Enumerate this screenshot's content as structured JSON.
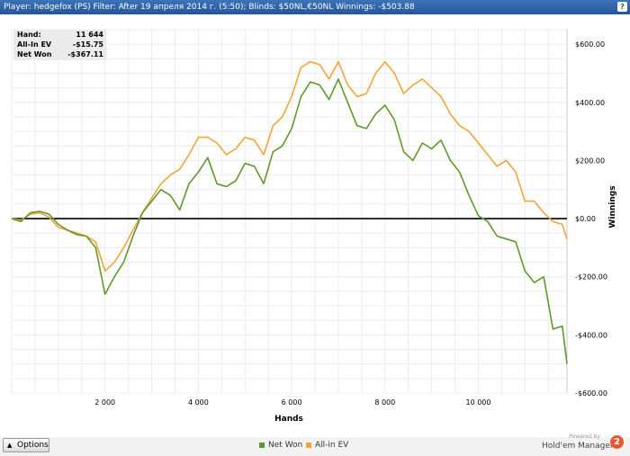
{
  "header": {
    "title": "Player: hedgefox (PS)  Filter:  After 19 апреля 2014 г. (5:50); Blinds: $50NL,€50NL  Winnings:  -$503.88",
    "help_label": "?"
  },
  "stats": [
    {
      "label": "Hand:",
      "value": "11 644"
    },
    {
      "label": "All-In EV",
      "value": "-$15.75"
    },
    {
      "label": "Net Won",
      "value": "-$367.11"
    }
  ],
  "options_label": "Options",
  "legend": [
    {
      "name": "Net Won",
      "color": "#5f9a2c"
    },
    {
      "name": "All-in EV",
      "color": "#f5a33c"
    }
  ],
  "powered": {
    "small": "Powered by",
    "brand": "Hold'em Manager",
    "logo": "2"
  },
  "colors": {
    "net_won": "#5f9a2c",
    "all_in_ev": "#f5a33c",
    "zero_line": "#000000",
    "title_bar": "#2c5ea3"
  },
  "chart_data": {
    "type": "line",
    "xlabel": "Hands",
    "ylabel": "Winnings",
    "xlim": [
      0,
      11900
    ],
    "ylim": [
      -600,
      650
    ],
    "x_ticks": [
      2000,
      4000,
      6000,
      8000,
      10000
    ],
    "x_tick_labels": [
      "2 000",
      "4 000",
      "6 000",
      "8 000",
      "10 000"
    ],
    "y_ticks": [
      600,
      400,
      200,
      0,
      -200,
      -400,
      -600
    ],
    "y_tick_labels": [
      "$600.00",
      "$400.00",
      "$200.00",
      "$0.00",
      "-$200.00",
      "-$400.00",
      "-$600.00"
    ],
    "grid": true,
    "legend_position": "bottom-center",
    "x": [
      0,
      200,
      400,
      600,
      800,
      1000,
      1200,
      1400,
      1600,
      1800,
      2000,
      2200,
      2400,
      2600,
      2800,
      3000,
      3200,
      3400,
      3600,
      3800,
      4000,
      4200,
      4400,
      4600,
      4800,
      5000,
      5200,
      5400,
      5600,
      5800,
      6000,
      6200,
      6400,
      6600,
      6800,
      7000,
      7200,
      7400,
      7600,
      7800,
      8000,
      8200,
      8400,
      8600,
      8800,
      9000,
      9200,
      9400,
      9600,
      9800,
      10000,
      10200,
      10400,
      10600,
      10800,
      11000,
      11200,
      11400,
      11600,
      11800,
      11900
    ],
    "series": [
      {
        "name": "Net Won",
        "values": [
          0,
          -10,
          20,
          25,
          15,
          -20,
          -40,
          -55,
          -60,
          -100,
          -260,
          -200,
          -150,
          -60,
          20,
          60,
          100,
          80,
          30,
          120,
          160,
          210,
          120,
          110,
          130,
          190,
          180,
          120,
          230,
          250,
          310,
          420,
          470,
          460,
          410,
          480,
          400,
          320,
          310,
          360,
          390,
          340,
          230,
          200,
          260,
          240,
          270,
          200,
          160,
          80,
          10,
          -10,
          -60,
          -70,
          -80,
          -180,
          -220,
          -200,
          -380,
          -370,
          -500
        ]
      },
      {
        "name": "All-in EV",
        "values": [
          0,
          -5,
          15,
          20,
          5,
          -30,
          -40,
          -50,
          -60,
          -80,
          -180,
          -150,
          -100,
          -40,
          20,
          70,
          120,
          150,
          170,
          220,
          280,
          280,
          260,
          220,
          240,
          280,
          270,
          220,
          320,
          350,
          420,
          520,
          540,
          530,
          480,
          540,
          460,
          420,
          430,
          500,
          540,
          500,
          430,
          460,
          480,
          450,
          420,
          360,
          320,
          300,
          260,
          220,
          180,
          200,
          160,
          60,
          60,
          20,
          -10,
          -20,
          -70
        ]
      }
    ]
  }
}
